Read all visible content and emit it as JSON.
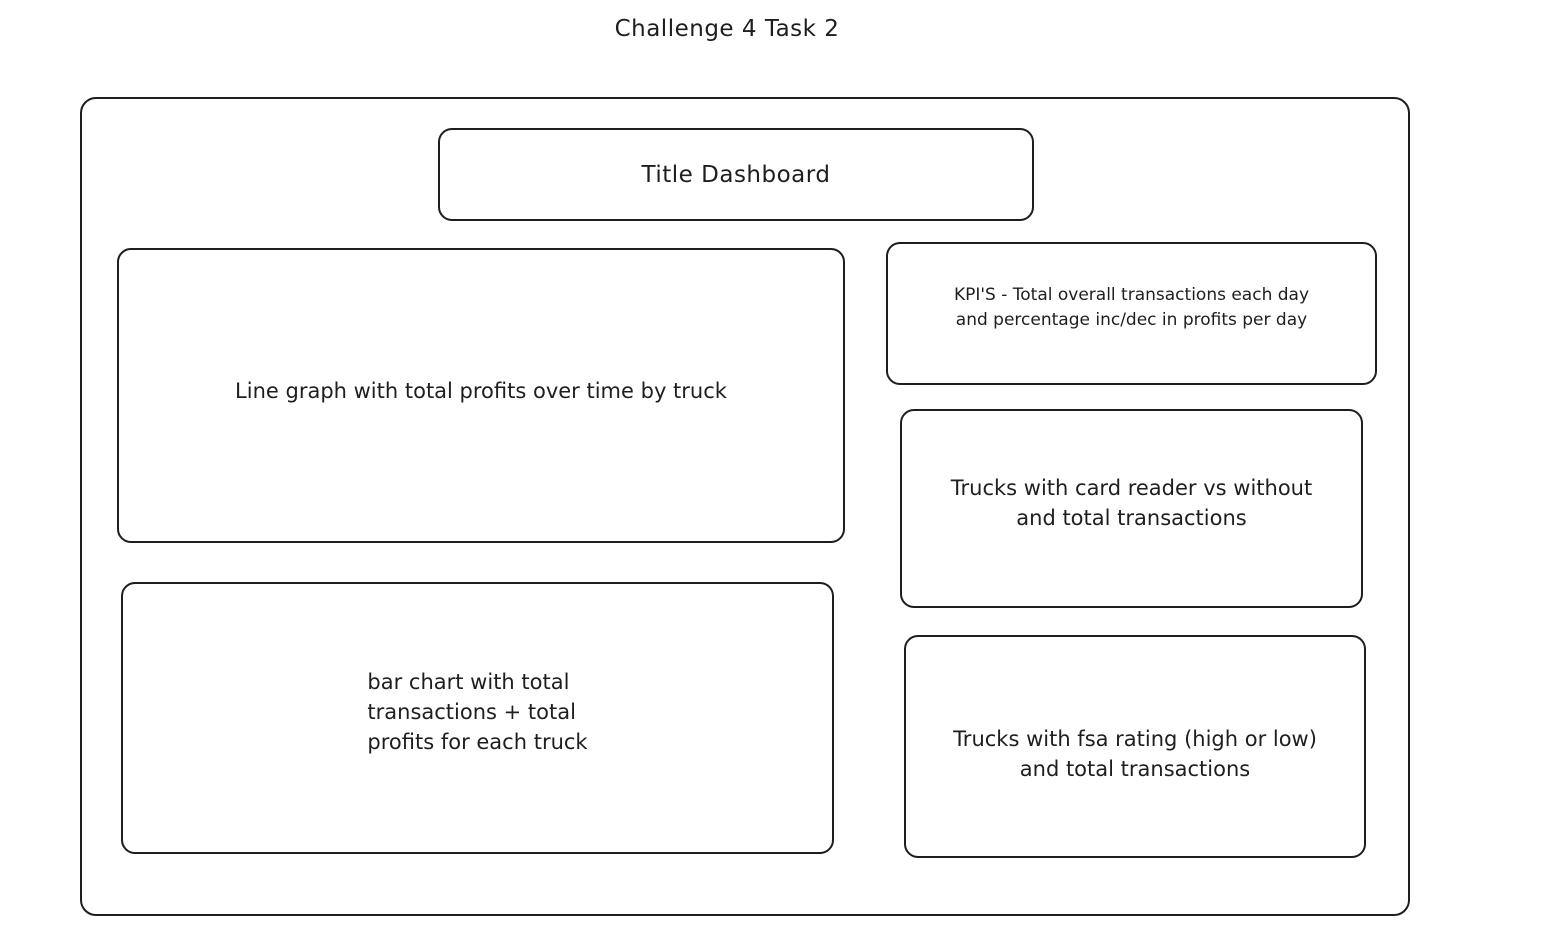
{
  "page_title": "Challenge 4 Task 2",
  "dashboard": {
    "title_box": "Title Dashboard",
    "line_graph_box": "Line graph with total profits over time by truck",
    "kpi_box": "KPI'S - Total overall transactions each day\nand percentage inc/dec in profits per day",
    "card_reader_box": "Trucks with card reader vs without\nand total transactions",
    "bar_chart_box": "bar chart with total\ntransactions + total\n profits for each truck",
    "fsa_box": "Trucks with fsa rating (high or low)\nand total transactions"
  }
}
